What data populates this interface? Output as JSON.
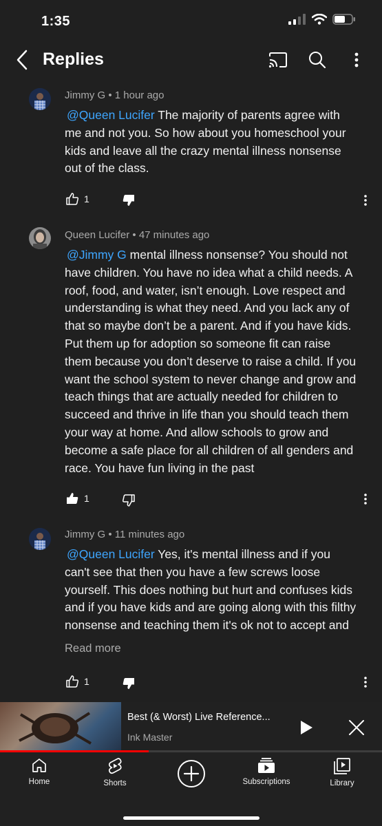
{
  "status": {
    "time": "1:35"
  },
  "header": {
    "title": "Replies",
    "back_icon": "chevron-left-icon",
    "cast_icon": "cast-icon",
    "search_icon": "search-icon",
    "menu_icon": "more-vertical-icon"
  },
  "comments": [
    {
      "author": "Jimmy G",
      "time": "1 hour ago",
      "mention": "@Queen Lucifer",
      "lines": [
        " The majority of parents agree with",
        "me and not you. So how about you homeschool your",
        "kids and leave all the crazy mental illness nonsense",
        "out of the class."
      ],
      "likes": "1",
      "liked": false,
      "disliked": true
    },
    {
      "author": "Queen Lucifer",
      "time": "47 minutes ago",
      "mention": "@Jimmy G",
      "lines": [
        " mental illness nonsense? You should not",
        "have children. You have no idea what a child needs. A",
        "roof, food, and water, isn’t enough. Love respect and",
        "understanding is what they need. And you lack any of",
        "that so maybe don’t be a parent. And if you have kids.",
        "Put them up for adoption so someone fit can raise",
        "them because you don’t deserve to raise a child. If you",
        "want the school system to never change and grow and",
        "teach things that are actually needed for children to",
        "succeed and thrive in life than you should teach them",
        "your way at home. And allow schools to grow and",
        "become a safe place for all children of all genders and",
        "race. You have fun living in the past"
      ],
      "likes": "1",
      "liked": true,
      "disliked": false
    },
    {
      "author": "Jimmy G",
      "time": "11 minutes ago",
      "mention": "@Queen Lucifer",
      "lines": [
        " Yes, it's mental illness and if you",
        "can't see that then you have a few screws loose",
        "yourself. This does nothing but hurt and confuses kids",
        "and if you have kids and are going along with this filthy",
        "nonsense and teaching them it's ok not to accept and"
      ],
      "read_more": "Read more",
      "likes": "1",
      "liked": false,
      "disliked": true
    }
  ],
  "mini_player": {
    "title": "Best (& Worst) Live Reference...",
    "channel": "Ink Master",
    "progress": 0.39,
    "accent": "#ff0000"
  },
  "nav": [
    {
      "label": "Home",
      "icon": "home-icon"
    },
    {
      "label": "Shorts",
      "icon": "shorts-icon"
    },
    {
      "label": "",
      "icon": "create-plus-icon"
    },
    {
      "label": "Subscriptions",
      "icon": "subscriptions-icon"
    },
    {
      "label": "Library",
      "icon": "library-icon"
    }
  ],
  "colors": {
    "background": "#202020",
    "mention": "#3ea6ff",
    "meta": "#aaaaaa"
  }
}
